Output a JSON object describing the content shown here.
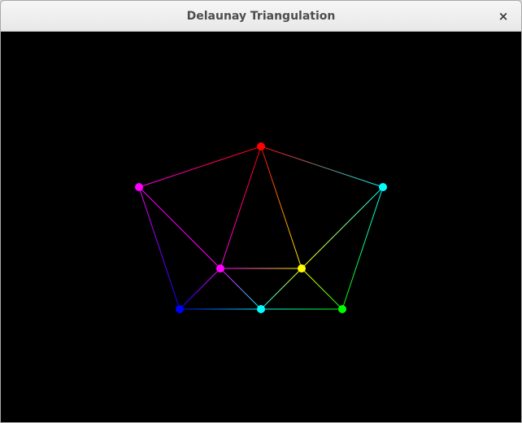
{
  "window": {
    "title": "Delaunay Triangulation",
    "close_glyph": "×",
    "close_icon": "close-icon"
  },
  "canvas": {
    "background": "#000000",
    "points": [
      {
        "id": "top",
        "color": "#ff0000"
      },
      {
        "id": "left",
        "color": "#ff00ff"
      },
      {
        "id": "right",
        "color": "#00ffff"
      },
      {
        "id": "inner-left",
        "color": "#ff00ff"
      },
      {
        "id": "inner-right",
        "color": "#ffff00"
      },
      {
        "id": "bottom-left",
        "color": "#0000ff"
      },
      {
        "id": "bottom-mid",
        "color": "#00ffff"
      },
      {
        "id": "bottom-right",
        "color": "#00ff00"
      }
    ],
    "edges": [
      [
        "left",
        "top"
      ],
      [
        "top",
        "right"
      ],
      [
        "left",
        "bottom-left"
      ],
      [
        "left",
        "inner-left"
      ],
      [
        "top",
        "inner-left"
      ],
      [
        "top",
        "inner-right"
      ],
      [
        "inner-left",
        "inner-right"
      ],
      [
        "inner-left",
        "bottom-left"
      ],
      [
        "inner-left",
        "bottom-mid"
      ],
      [
        "inner-right",
        "bottom-mid"
      ],
      [
        "inner-right",
        "right"
      ],
      [
        "inner-right",
        "bottom-right"
      ],
      [
        "right",
        "bottom-right"
      ],
      [
        "bottom-left",
        "bottom-mid"
      ],
      [
        "bottom-mid",
        "bottom-right"
      ]
    ]
  }
}
